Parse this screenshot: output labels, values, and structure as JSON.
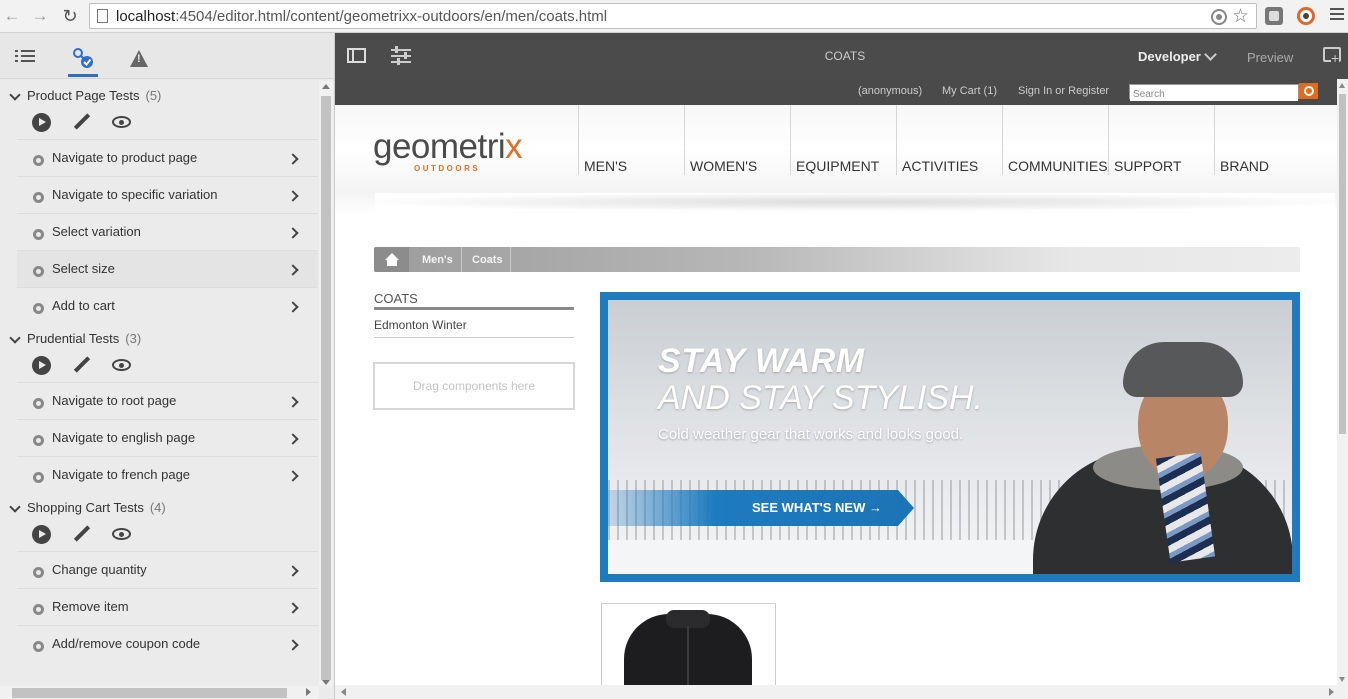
{
  "browser": {
    "url_host": "localhost",
    "url_rest": ":4504/editor.html/content/geometrixx-outdoors/en/men/coats.html",
    "icons": [
      "back-icon",
      "forward-icon",
      "reload-icon",
      "page-icon",
      "target-icon",
      "star-icon",
      "extension-icon",
      "extension-icon",
      "menu-icon"
    ]
  },
  "panel": {
    "tabs": [
      {
        "name": "content-tree",
        "icon": "list-icon"
      },
      {
        "name": "tests",
        "icon": "tests-icon",
        "active": true
      },
      {
        "name": "alerts",
        "icon": "warning-icon"
      }
    ],
    "suites": [
      {
        "title": "Product Page Tests",
        "count": "(5)",
        "cases": [
          "Navigate to product page",
          "Navigate to specific variation",
          "Select variation",
          "Select size",
          "Add to cart"
        ]
      },
      {
        "title": "Prudential Tests",
        "count": "(3)",
        "cases": [
          "Navigate to root page",
          "Navigate to english page",
          "Navigate to french page"
        ]
      },
      {
        "title": "Shopping Cart Tests",
        "count": "(4)",
        "cases": [
          "Change quantity",
          "Remove item",
          "Add/remove coupon code"
        ]
      }
    ]
  },
  "editor": {
    "title": "COATS",
    "mode": "Developer",
    "preview": "Preview"
  },
  "site": {
    "topbar": {
      "user": "(anonymous)",
      "cart": "My Cart (1)",
      "signin": "Sign In or Register",
      "search_placeholder": "Search"
    },
    "logo": {
      "main": "geometri",
      "x": "x",
      "sub": "OUTDOORS"
    },
    "nav": [
      "MEN'S",
      "WOMEN'S",
      "EQUIPMENT",
      "ACTIVITIES",
      "COMMUNITIES",
      "SUPPORT",
      "BRAND"
    ],
    "breadcrumb": [
      "Men's",
      "Coats"
    ],
    "subnav": {
      "title": "COATS",
      "items": [
        "Edmonton Winter"
      ]
    },
    "dropzone": "Drag components here",
    "hero": {
      "line1": "STAY WARM",
      "line2": "AND STAY STYLISH.",
      "sub": "Cold weather gear that works and looks good.",
      "cta": "SEE WHAT'S NEW →",
      "border_color": "#1f7bc0"
    },
    "accent": "#e36d26"
  }
}
